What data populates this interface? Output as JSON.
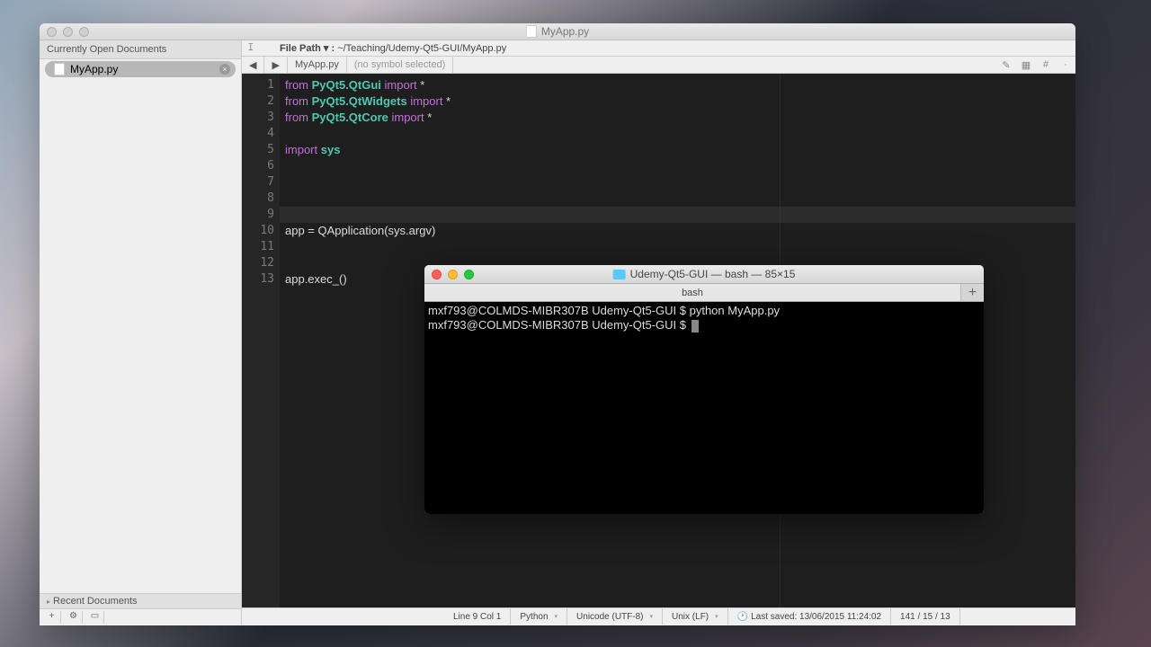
{
  "editor": {
    "title": "MyApp.py",
    "sidebar": {
      "open_header": "Currently Open Documents",
      "items": [
        {
          "name": "MyApp.py"
        }
      ],
      "recent_header": "Recent Documents"
    },
    "pathbar": {
      "label": "File Path ▾ :",
      "path": "~/Teaching/Udemy-Qt5-GUI/MyApp.py"
    },
    "navbar": {
      "back": "◀",
      "fwd": "▶",
      "file": "MyApp.py",
      "symbol": "(no symbol selected)"
    },
    "code": {
      "lines": [
        {
          "n": "1",
          "tokens": [
            {
              "t": "from ",
              "c": "kw"
            },
            {
              "t": "PyQt5.QtGui",
              "c": "mod"
            },
            {
              "t": " import ",
              "c": "kw"
            },
            {
              "t": "*",
              "c": "star"
            }
          ]
        },
        {
          "n": "2",
          "tokens": [
            {
              "t": "from ",
              "c": "kw"
            },
            {
              "t": "PyQt5.QtWidgets",
              "c": "mod"
            },
            {
              "t": " import ",
              "c": "kw"
            },
            {
              "t": "*",
              "c": "star"
            }
          ]
        },
        {
          "n": "3",
          "tokens": [
            {
              "t": "from ",
              "c": "kw"
            },
            {
              "t": "PyQt5.QtCore",
              "c": "mod"
            },
            {
              "t": " import ",
              "c": "kw"
            },
            {
              "t": "*",
              "c": "star"
            }
          ]
        },
        {
          "n": "4",
          "tokens": []
        },
        {
          "n": "5",
          "tokens": [
            {
              "t": "import ",
              "c": "kw"
            },
            {
              "t": "sys",
              "c": "mod"
            }
          ]
        },
        {
          "n": "6",
          "tokens": []
        },
        {
          "n": "7",
          "tokens": []
        },
        {
          "n": "8",
          "tokens": []
        },
        {
          "n": "9",
          "tokens": []
        },
        {
          "n": "10",
          "tokens": [
            {
              "t": "app = QApplication(sys.argv)",
              "c": ""
            }
          ]
        },
        {
          "n": "11",
          "tokens": []
        },
        {
          "n": "12",
          "tokens": []
        },
        {
          "n": "13",
          "tokens": [
            {
              "t": "app.exec_()",
              "c": ""
            }
          ]
        }
      ]
    },
    "status": {
      "pos": "Line 9 Col 1",
      "lang": "Python",
      "enc": "Unicode (UTF-8)",
      "eol": "Unix (LF)",
      "saved": "Last saved: 13/06/2015 11:24:02",
      "counts": "141 / 15 / 13"
    }
  },
  "terminal": {
    "title": "Udemy-Qt5-GUI — bash — 85×15",
    "tab": "bash",
    "lines": [
      "mxf793@COLMDS-MIBR307B Udemy-Qt5-GUI $ python MyApp.py",
      "mxf793@COLMDS-MIBR307B Udemy-Qt5-GUI $ "
    ]
  }
}
